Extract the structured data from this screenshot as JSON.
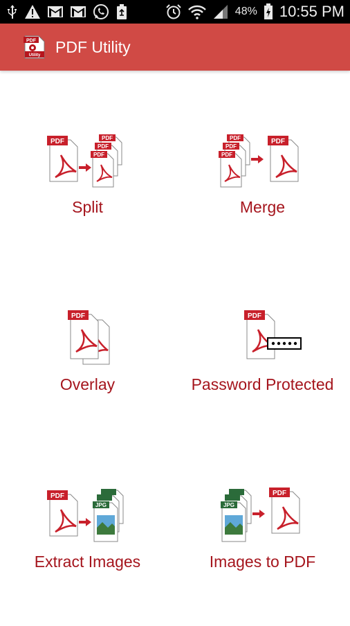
{
  "status_bar": {
    "battery_percent": "48%",
    "time": "10:55 PM",
    "left_icons": [
      "usb-icon",
      "warning-icon",
      "gmail-icon",
      "gmail-icon",
      "whatsapp-icon",
      "recycle-icon"
    ],
    "right_icons": [
      "alarm-icon",
      "wifi-icon",
      "signal-icon",
      "battery-icon"
    ]
  },
  "app_bar": {
    "title": "PDF Utility",
    "logo_text_top": "PDF",
    "logo_text_bottom": "Utility",
    "color": "#d04a45"
  },
  "tools": [
    {
      "label": "Split",
      "icon": "split-pdf-icon"
    },
    {
      "label": "Merge",
      "icon": "merge-pdf-icon"
    },
    {
      "label": "Overlay",
      "icon": "overlay-pdf-icon"
    },
    {
      "label": "Password Protected",
      "icon": "password-pdf-icon"
    },
    {
      "label": "Extract Images",
      "icon": "extract-images-icon"
    },
    {
      "label": "Images to PDF",
      "icon": "images-to-pdf-icon"
    }
  ],
  "doc_icon_text": {
    "pdf": "PDF",
    "jpg": "JPG"
  },
  "colors": {
    "label": "#a5151d",
    "pdf_red": "#c8202b",
    "accent": "#d04a45"
  }
}
